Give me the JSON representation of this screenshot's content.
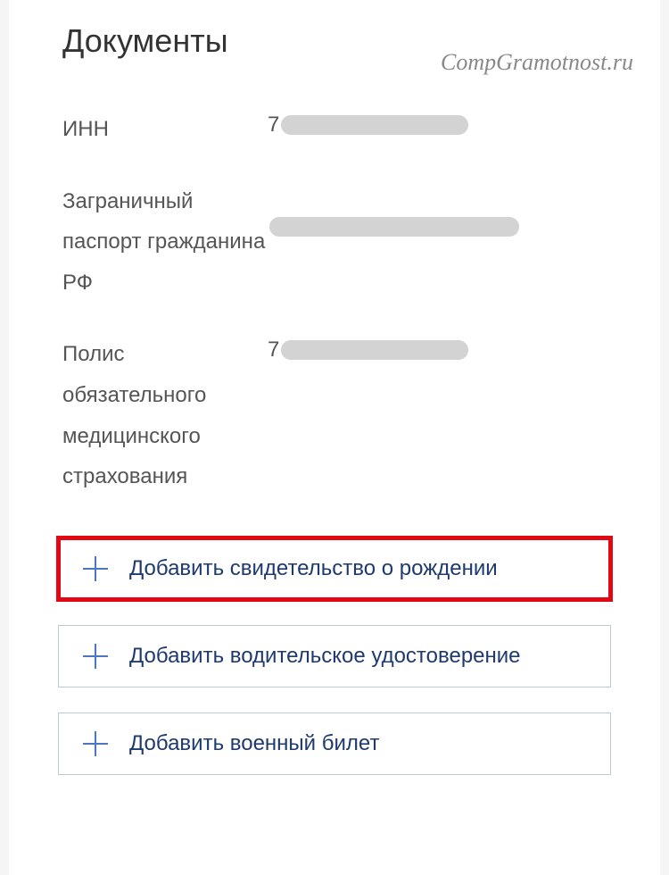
{
  "page": {
    "title": "Документы",
    "watermark": "CompGramotnost.ru"
  },
  "documents": [
    {
      "label": "ИНН",
      "value_prefix": "7"
    },
    {
      "label": "Заграничный паспорт гражданина РФ",
      "value_prefix": ""
    },
    {
      "label": "Полис обязательного медицинского страхования",
      "value_prefix": "7"
    }
  ],
  "buttons": [
    {
      "label": "Добавить свидетельство о рождении",
      "highlighted": true
    },
    {
      "label": "Добавить водительское удостоверение",
      "highlighted": false
    },
    {
      "label": "Добавить военный билет",
      "highlighted": false
    }
  ]
}
